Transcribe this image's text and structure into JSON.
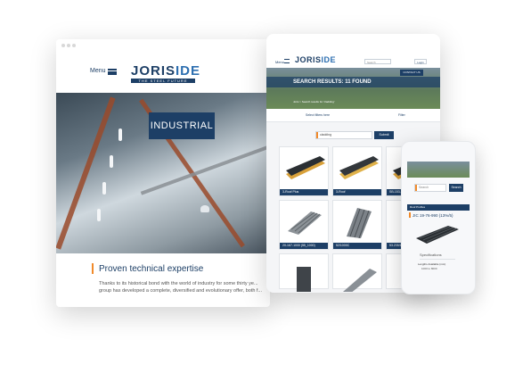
{
  "desktop": {
    "menu_label": "Menu",
    "logo_main": "JORIS",
    "logo_accent": "IDE",
    "logo_tagline": "THE STEEL FUTURE",
    "hero_badge": "INDUSTRIAL",
    "heading": "Proven technical expertise",
    "paragraph": "Thanks to its historical bond with the world of industry for some thirty ye... group has developed a complete, diversified and evolutionary offer, both f..."
  },
  "tablet": {
    "menu_label": "Menu",
    "logo_main": "JORIS",
    "logo_accent": "IDE",
    "search_placeholder": "Search",
    "login_label": "Login",
    "contact_label": "CONTACT US",
    "hero_title": "SEARCH RESULTS: 11 FOUND",
    "breadcrumb": "Joris > Search results for 'cladding'",
    "filter_left": "Select filters here",
    "filter_right": "Filter",
    "search_value": "cladding",
    "search_button": "Submit",
    "products": [
      {
        "label": "3-Roof Plus"
      },
      {
        "label": "3-Roof"
      },
      {
        "label": "SB-153-90..."
      },
      {
        "label": "20-167-1000 (55_1000)"
      },
      {
        "label": "52/1000C"
      },
      {
        "label": "53.235/1000..."
      },
      {
        "label": ""
      },
      {
        "label": ""
      },
      {
        "label": ""
      }
    ]
  },
  "phone": {
    "search_placeholder": "Search",
    "search_button": "Search",
    "band_label": "Roof Profiles",
    "product_code": "JIC 19-76-990 (13%/5)",
    "spec_title": "Specifications",
    "length_label": "Lengths Available (mm)",
    "length_value": "1000 to 8000"
  },
  "colors": {
    "brand_navy": "#1d3f66",
    "brand_blue": "#2d6fb0",
    "accent_orange": "#f18a2a"
  }
}
